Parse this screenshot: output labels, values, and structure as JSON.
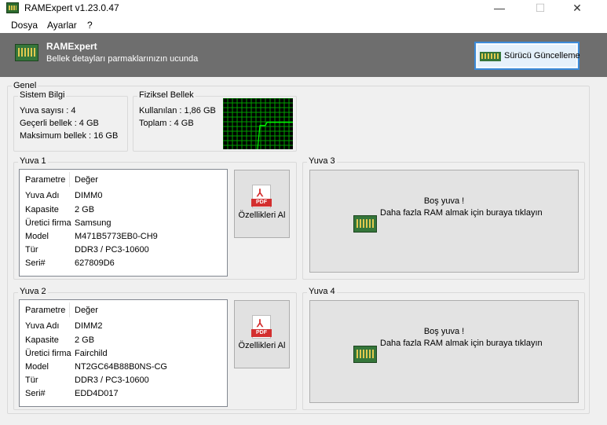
{
  "window": {
    "title": "RAMExpert v1.23.0.47",
    "minimize": "—",
    "maximize": "☐",
    "close": "✕"
  },
  "menu": {
    "items": [
      "Dosya",
      "Ayarlar",
      "?"
    ]
  },
  "banner": {
    "title": "RAMExpert",
    "subtitle": "Bellek detayları parmaklarınızın ucunda",
    "update_button": "Sürücü Güncelleme"
  },
  "general": {
    "legend": "Genel",
    "system": {
      "legend": "Sistem Bilgi",
      "lines": [
        "Yuva sayısı : 4",
        "Geçerli bellek : 4 GB",
        "Maksimum bellek : 16 GB"
      ]
    },
    "physical": {
      "legend": "Fiziksel Bellek",
      "used": "Kullanılan : 1,86 GB",
      "total": "Toplam : 4 GB",
      "usage_fraction": 0.465,
      "grid_color": "#00a000",
      "line_color": "#00ff00"
    }
  },
  "slots": [
    {
      "legend": "Yuva 1",
      "col_param": "Parametre",
      "col_value": "Değer",
      "rows": [
        [
          "Yuva Adı",
          "DIMM0"
        ],
        [
          "Kapasite",
          "2 GB"
        ],
        [
          "Üretici firma",
          "Samsung"
        ],
        [
          "Model",
          "M471B5773EB0-CH9"
        ],
        [
          "Tür",
          "DDR3 / PC3-10600"
        ],
        [
          "Seri#",
          "627809D6"
        ]
      ],
      "pdf_button": "Özellikleri Al",
      "pdf_icon": "pdf-icon"
    },
    {
      "legend": "Yuva 2",
      "col_param": "Parametre",
      "col_value": "Değer",
      "rows": [
        [
          "Yuva Adı",
          "DIMM2"
        ],
        [
          "Kapasite",
          "2 GB"
        ],
        [
          "Üretici firma",
          "Fairchild"
        ],
        [
          "Model",
          "NT2GC64B88B0NS-CG"
        ],
        [
          "Tür",
          "DDR3 / PC3-10600"
        ],
        [
          "Seri#",
          "EDD4D017"
        ]
      ],
      "pdf_button": "Özellikleri Al",
      "pdf_icon": "pdf-icon"
    },
    {
      "legend": "Yuva 3",
      "empty_line1": "Boş yuva !",
      "empty_line2": "Daha fazla RAM almak için buraya tıklayın"
    },
    {
      "legend": "Yuva 4",
      "empty_line1": "Boş yuva !",
      "empty_line2": "Daha fazla RAM almak için buraya tıklayın"
    }
  ]
}
